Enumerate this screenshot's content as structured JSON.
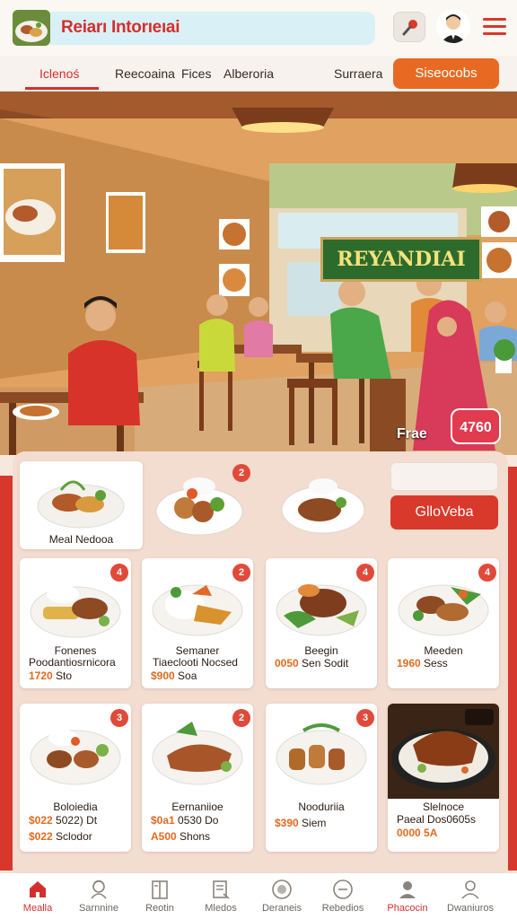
{
  "header": {
    "title": "Reiarı Intorıeıai"
  },
  "nav": {
    "tabs": [
      "Iclenoś",
      "Reecoaina",
      "Fices",
      "Alberoria",
      "Surraera"
    ],
    "cta_label": "Siseocobs"
  },
  "hero": {
    "sign_text": "REYANDIAI",
    "caption": "Frae",
    "badge": "4760"
  },
  "featured": {
    "caption": "Meal Nedooa",
    "badge": "2",
    "checkout_label": "GlloVeba"
  },
  "menu": [
    {
      "badge": "4",
      "name": "Fonenes",
      "line2": "Poodantiosrnicora",
      "price": "1720",
      "line3": "Sto"
    },
    {
      "badge": "2",
      "name": "Semaner",
      "line2": "Tiaeclooti Nocsed",
      "price": "$900",
      "line3": "Soa"
    },
    {
      "badge": "4",
      "name": "Beegin",
      "price": "0050",
      "line3": "Sen Sodit"
    },
    {
      "badge": "4",
      "name": "Meeden",
      "price": "1960",
      "line3": "Sess"
    },
    {
      "badge": "3",
      "name": "Boloiedia",
      "price": "$022",
      "line2": "5022) Dt",
      "line3a": "$022",
      "line3": "Sclodor"
    },
    {
      "badge": "2",
      "name": "Eernaniioe",
      "price": "$0a1",
      "line2": "0530 Do",
      "line3a": "A500",
      "line3": "Shons"
    },
    {
      "badge": "3",
      "name": "Nooduriia",
      "price": "$390",
      "line3": "Siem"
    },
    {
      "name": "Slelnoce",
      "line2": "Paeal Dos0605s",
      "line3a": "0000",
      "line3": "5A"
    }
  ],
  "bottom_nav": [
    {
      "label": "Mealla",
      "icon": "home-icon"
    },
    {
      "label": "Sarnnine",
      "icon": "chef-icon"
    },
    {
      "label": "Reotin",
      "icon": "menu-book-icon"
    },
    {
      "label": "Mledos",
      "icon": "list-icon"
    },
    {
      "label": "Deraneis",
      "icon": "plate-icon"
    },
    {
      "label": "Rebedios",
      "icon": "minus-circle-icon"
    },
    {
      "label": "Phacocin",
      "icon": "person-icon"
    },
    {
      "label": "Dwaniuros",
      "icon": "user-icon"
    }
  ],
  "colors": {
    "accent_red": "#d62e2e",
    "accent_orange": "#e86a22"
  }
}
